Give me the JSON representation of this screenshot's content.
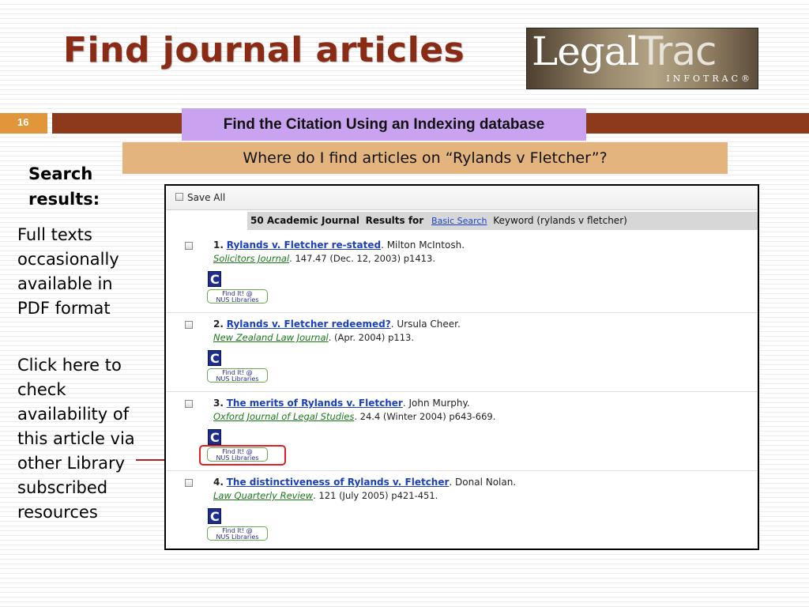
{
  "slide": {
    "title": "Find journal articles",
    "number": "16",
    "logo": {
      "main": "Legal",
      "main2": "Trac",
      "sub": "INFOTRAC®"
    },
    "banner_purple": "Find the Citation Using an Indexing database",
    "banner_tan": "Where do I find articles on “Rylands v Fletcher”?",
    "side_heading": "Search results:",
    "side_note_1": [
      "Full texts",
      "occasionally",
      "available in",
      "PDF format"
    ],
    "side_note_2": [
      "Click here to",
      "check",
      "availability of",
      "this article via",
      "other Library",
      "subscribed",
      "resources"
    ]
  },
  "colors": {
    "title": "#8a2b15",
    "number_bar": "#e2963b",
    "brown_bar": "#8d3a1c",
    "purple_banner": "#c9a3f0",
    "tan_banner": "#e4b47f",
    "link": "#1a3fbf",
    "journal_link": "#177a17",
    "highlight": "#e02020"
  },
  "screenshot": {
    "save_all": "Save All",
    "results_count": "50 Academic Journal",
    "results_label": "Results for",
    "search_type": "Basic Search",
    "keyword": "Keyword (rylands v fletcher)",
    "results": [
      {
        "num": "1.",
        "title": "Rylands v. Fletcher re-stated",
        "author": ". Milton McIntosh.",
        "journal": "Solicitors Journal",
        "citation": ". 147.47 (Dec. 12, 2003) p1413."
      },
      {
        "num": "2.",
        "title": "Rylands v. Fletcher redeemed?",
        "author": ". Ursula Cheer.",
        "journal": "New Zealand Law Journal",
        "citation": ". (Apr. 2004) p113."
      },
      {
        "num": "3.",
        "title": "The merits of Rylands v. Fletcher",
        "author": ". John Murphy.",
        "journal": "Oxford Journal of Legal Studies",
        "citation": ". 24.4 (Winter 2004) p643-669."
      },
      {
        "num": "4.",
        "title": "The distinctiveness of Rylands v. Fletcher",
        "author": ". Donal Nolan.",
        "journal": "Law Quarterly Review",
        "citation": ". 121 (July 2005) p421-451."
      }
    ],
    "findit": {
      "line1": "Find It! @",
      "line2": "NUS Libraries"
    },
    "c_icon": "C"
  }
}
